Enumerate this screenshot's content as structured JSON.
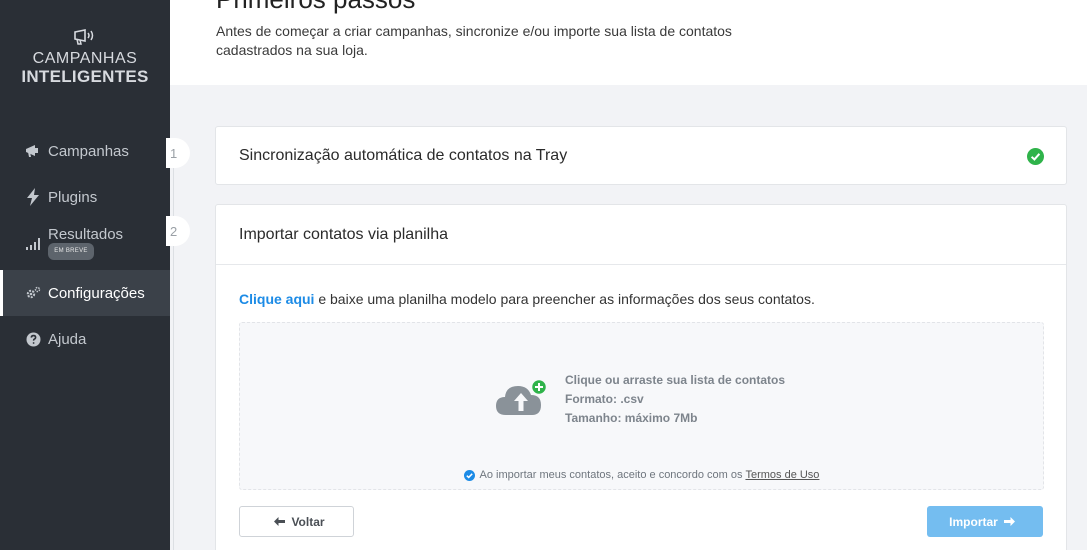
{
  "brand": {
    "icon": "megaphone-icon",
    "line1": "CAMPANHAS",
    "line2": "INTELIGENTES"
  },
  "sidebar": {
    "items": [
      {
        "label": "Campanhas",
        "icon": "megaphone-icon",
        "active": false
      },
      {
        "label": "Plugins",
        "icon": "bolt-icon",
        "active": false
      },
      {
        "label": "Resultados",
        "icon": "bar-chart-icon",
        "badge": "EM BREVE",
        "active": false
      },
      {
        "label": "Configurações",
        "icon": "gear-icon",
        "active": true
      },
      {
        "label": "Ajuda",
        "icon": "question-icon",
        "active": false
      }
    ]
  },
  "header": {
    "title": "Primeiros passos",
    "description": "Antes de começar a criar campanhas, sincronize e/ou importe sua lista de contatos cadastrados na sua loja."
  },
  "steps": [
    {
      "number": "1",
      "title": "Sincronização automática de contatos na Tray",
      "status_icon": "check-circle-icon"
    },
    {
      "number": "2",
      "title": "Importar contatos via planilha",
      "instruction_link": "Clique aqui",
      "instruction_rest": " e baixe uma planilha modelo para preencher as informações dos seus contatos.",
      "dropzone": {
        "icon": "cloud-upload-icon",
        "line1": "Clique ou arraste sua lista de contatos",
        "line2": "Formato: .csv",
        "line3": "Tamanho: máximo 7Mb"
      },
      "terms_text": "Ao importar meus contatos, aceito e concordo com os",
      "terms_link": "Termos de Uso",
      "back_label": "Voltar",
      "import_label": "Importar"
    }
  ],
  "colors": {
    "sidebar_bg": "#2a2f36",
    "accent": "#1c8be6",
    "success": "#2fb34a",
    "import_button": "#74bdf0"
  }
}
